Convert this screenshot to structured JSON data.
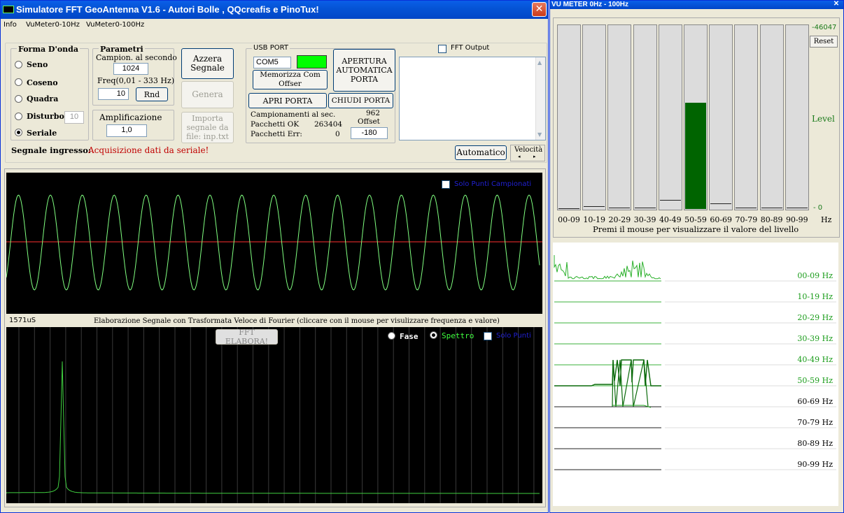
{
  "main_window": {
    "title": "Simulatore FFT GeoAntenna V1.6 - Autori Bolle , QQcreafis e PinoTux!",
    "close_symbol": "✕",
    "menu": [
      "Info",
      "VuMeter0-10Hz",
      "VuMeter0-100Hz"
    ]
  },
  "waveform": {
    "title": "Forma D'onda",
    "options": [
      "Seno",
      "Coseno",
      "Quadra",
      "Disturbo",
      "Seriale"
    ],
    "selected": "Seriale",
    "disturbo_value": "10"
  },
  "parametri": {
    "title": "Parametri",
    "campion_label": "Campion. al secondo",
    "campion_value": "1024",
    "freq_label": "Freq(0,01 -  333  Hz)",
    "freq_value": "10",
    "rnd_label": "Rnd"
  },
  "amplificazione": {
    "label": "Amplificazione",
    "value": "1,0"
  },
  "buttons": {
    "azzera": "Azzera Segnale",
    "genera": "Genera",
    "importa": "Importa segnale da file: inp.txt"
  },
  "usb": {
    "title": "USB PORT",
    "port_value": "COM5",
    "status_color": "#00ff00",
    "memorizza": "Memorizza Com Offser",
    "apertura": "APERTURA AUTOMATICA PORTA",
    "apri": "APRI PORTA",
    "chiudi": "CHIUDI PORTA",
    "campionamenti_label": "Campionamenti al sec.",
    "campionamenti_value": "962",
    "pacchetti_ok_label": "Pacchetti OK",
    "pacchetti_ok_value": "263404",
    "pacchetti_err_label": "Pacchetti Err:",
    "pacchetti_err_value": "0",
    "offset_label": "Offset",
    "offset_value": "-180"
  },
  "fft_output": {
    "label": "FFT Output",
    "checked": false
  },
  "signal": {
    "label": "Segnale ingresso:",
    "status": "Acquisizione dati da seriale!",
    "status_color": "#c00000"
  },
  "automatico": "Automatico",
  "velocita": "Velocità",
  "scope": {
    "solo_punti_label": "Solo Punti Campionati",
    "time_label": "1571uS",
    "fft_caption": "Elaborazione Segnale con Trasformata Veloce di Fourier (cliccare con il mouse per visulizzare frequenza e valore)",
    "wave_color": "#80ff80",
    "center_line_color": "#ff3030"
  },
  "fft_panel": {
    "elabora": "FFT ELABORA!",
    "fase": "Fase",
    "spettro": "Spettro",
    "spettro_selected": true,
    "solo_punti": "Solo Punti"
  },
  "vu_window": {
    "title": "VU METER 0Hz - 100Hz",
    "close_symbol": "✕",
    "top_value": "-46047",
    "reset": "Reset",
    "level_label": "Level",
    "zero_label": "- 0",
    "hz_label": "Hz",
    "hint": "Premi il mouse per visualizzare il valore del livello",
    "bands": [
      "00-09",
      "10-19",
      "20-29",
      "30-39",
      "40-49",
      "50-59",
      "60-69",
      "70-79",
      "80-89",
      "90-99"
    ],
    "levels": [
      0.004,
      0.015,
      0.008,
      0.008,
      0.05,
      0.58,
      0.03,
      0.008,
      0.008,
      0.008
    ],
    "bar_fill": "#006400",
    "history_labels": [
      "00-09 Hz",
      "10-19 Hz",
      "20-29 Hz",
      "30-39 Hz",
      "40-49 Hz",
      "50-59 Hz",
      "60-69 Hz",
      "70-79 Hz",
      "80-89 Hz",
      "90-99 Hz"
    ]
  }
}
